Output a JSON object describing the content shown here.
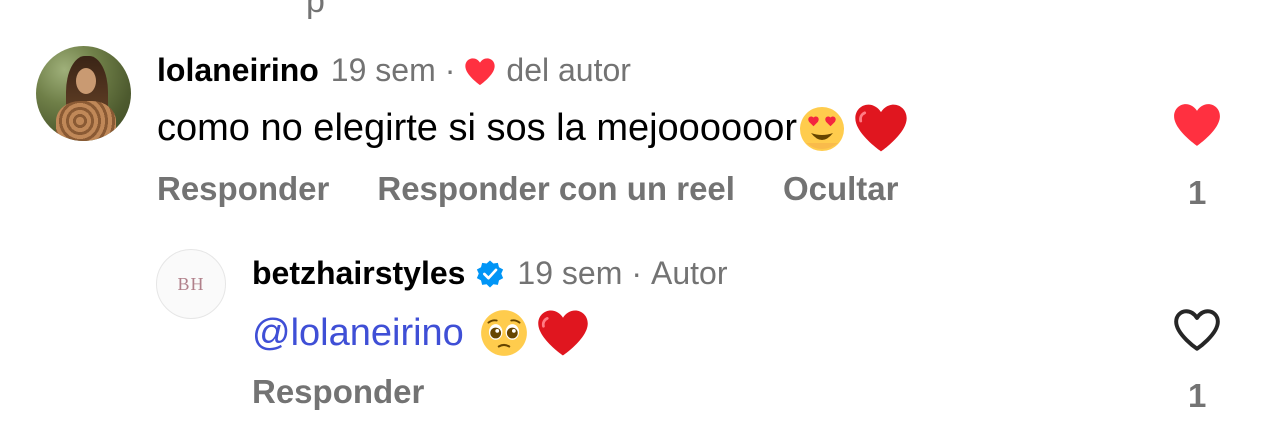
{
  "top_cut_text": "p",
  "comments": [
    {
      "username": "lolaneirino",
      "time": "19 sem",
      "author_like_label": "del autor",
      "text": "como no elegirte si sos la mejoooooor",
      "actions": [
        "Responder",
        "Responder con un reel",
        "Ocultar"
      ],
      "likes": "1",
      "liked": true
    },
    {
      "username": "betzhairstyles",
      "time": "19 sem",
      "badge": "Autor",
      "mention": "@lolaneirino",
      "actions": [
        "Responder"
      ],
      "likes": "1",
      "liked": false,
      "avatar_logo": "BH"
    }
  ],
  "colors": {
    "heart_red": "#ff3040",
    "gray_text": "#737373",
    "mention_blue": "#3f4fd6",
    "verified_blue": "#0095f6"
  },
  "icons": {
    "author_heart": "heart-filled-icon",
    "verified": "verified-badge-icon",
    "like_filled": "heart-filled-icon",
    "like_outline": "heart-outline-icon"
  }
}
